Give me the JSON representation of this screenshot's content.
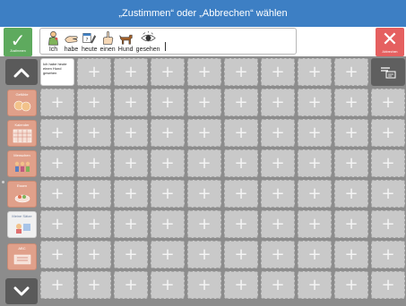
{
  "title": "„Zustimmen“ oder „Abbrechen“ wählen",
  "confirm_button": {
    "label": "Zustimmen",
    "icon": "check-icon"
  },
  "cancel_button": {
    "label": "Abbrechen",
    "icon": "close-icon"
  },
  "sentence": {
    "words": [
      {
        "text": "Ich",
        "icon": "person-icon"
      },
      {
        "text": "habe",
        "icon": "hand-holding-icon"
      },
      {
        "text": "heute",
        "icon": "today-calendar-icon"
      },
      {
        "text": "einen",
        "icon": "one-finger-icon"
      },
      {
        "text": "Hund",
        "icon": "dog-icon"
      },
      {
        "text": "gesehen",
        "icon": "eye-icon"
      }
    ]
  },
  "sidebar": {
    "up_icon": "chevron-up-icon",
    "down_icon": "chevron-down-icon",
    "categories": [
      {
        "label": "Gefühle",
        "icon": "faces-icon"
      },
      {
        "label": "Kalender",
        "icon": "calendar-icon"
      },
      {
        "label": "Menschen",
        "icon": "people-icon"
      },
      {
        "label": "Essen",
        "icon": "food-icon"
      },
      {
        "label": "Meine Sätze",
        "icon": "sentences-icon"
      },
      {
        "label": "ABC",
        "icon": "alphabet-icon"
      }
    ]
  },
  "grid": {
    "filled_cell_text": "Ich habe heute einen Hund gesehen",
    "empty_cell_icon": "plus-icon",
    "tool_icon": "edit-list-icon"
  },
  "colors": {
    "titlebar": "#3d7fc4",
    "confirm": "#5eaa5e",
    "cancel": "#e56060",
    "grid_background": "#8c8c8c",
    "empty_cell": "#c9c9c9"
  }
}
